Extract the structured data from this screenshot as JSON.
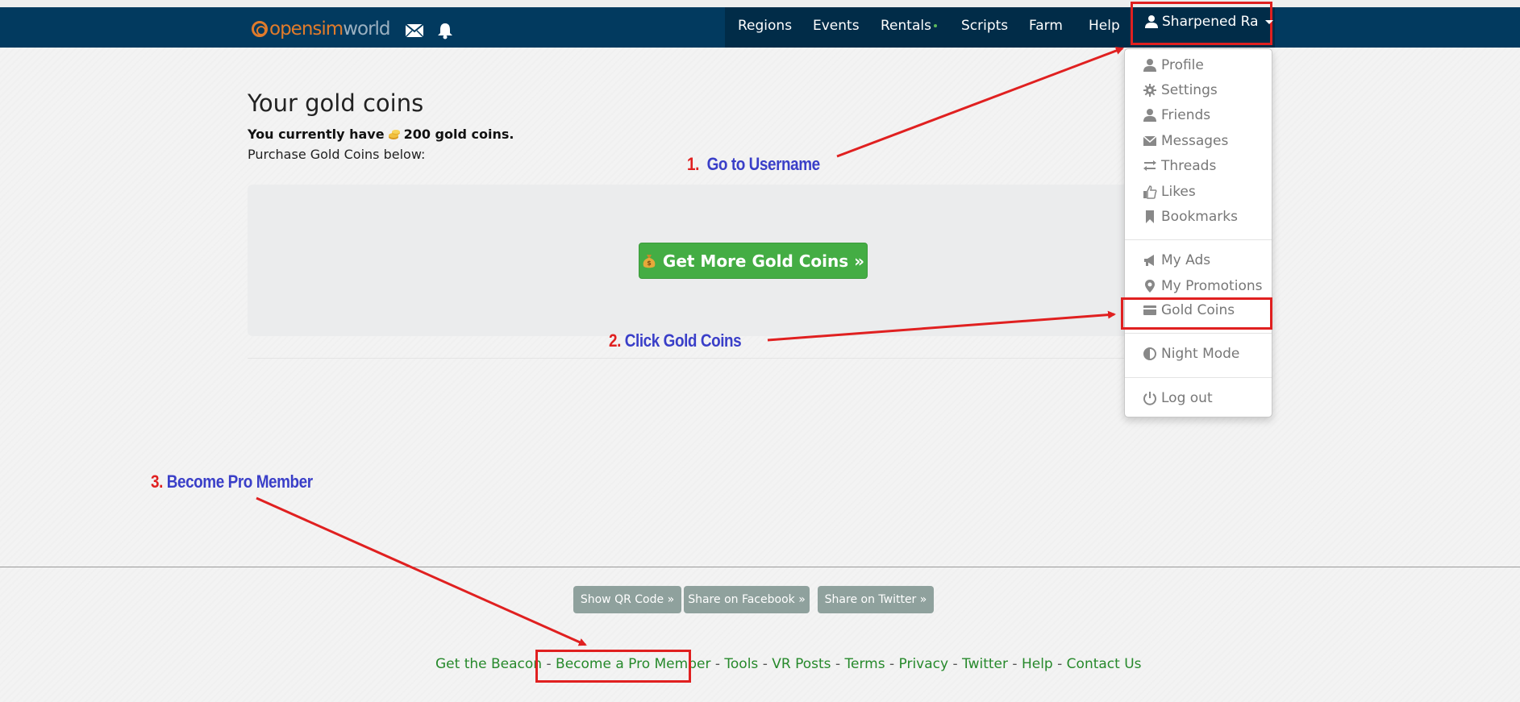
{
  "brand": {
    "part1": "opensim",
    "part2": "world"
  },
  "nav": {
    "items": [
      "Regions",
      "Events",
      "Rentals",
      "Scripts",
      "Farm",
      "Help"
    ],
    "user": "Sharpened Ra"
  },
  "main": {
    "title": "Your gold coins",
    "coins_prefix": "You currently have",
    "coins_suffix": "200 gold coins.",
    "purchase_text": "Purchase Gold Coins below:",
    "gold_button": "Get More Gold Coins »"
  },
  "dropdown": {
    "items": [
      "Profile",
      "Settings",
      "Friends",
      "Messages",
      "Threads",
      "Likes",
      "Bookmarks",
      "My Ads",
      "My Promotions",
      "Gold Coins",
      "Night Mode",
      "Log out"
    ]
  },
  "annotations": {
    "step1_num": "1.",
    "step1_text": "Go to Username",
    "step2_num": "2.",
    "step2_text": "Click Gold Coins",
    "step3_num": "3.",
    "step3_text": "Become Pro Member",
    "highlight_color": "#e02020",
    "text_color": "#3a3fc8"
  },
  "footer": {
    "share_buttons": [
      "Show QR Code »",
      "Share on Facebook »",
      "Share on Twitter »"
    ],
    "links": [
      "Get the Beacon",
      "Become a Pro Member",
      "Tools",
      "VR Posts",
      "Terms",
      "Privacy",
      "Twitter",
      "Help",
      "Contact Us"
    ],
    "separator": "-"
  },
  "colors": {
    "navbar": "#023a5f",
    "gold_button": "#44ad44",
    "share_button": "#8fa19d",
    "footer_link": "#26892b"
  }
}
